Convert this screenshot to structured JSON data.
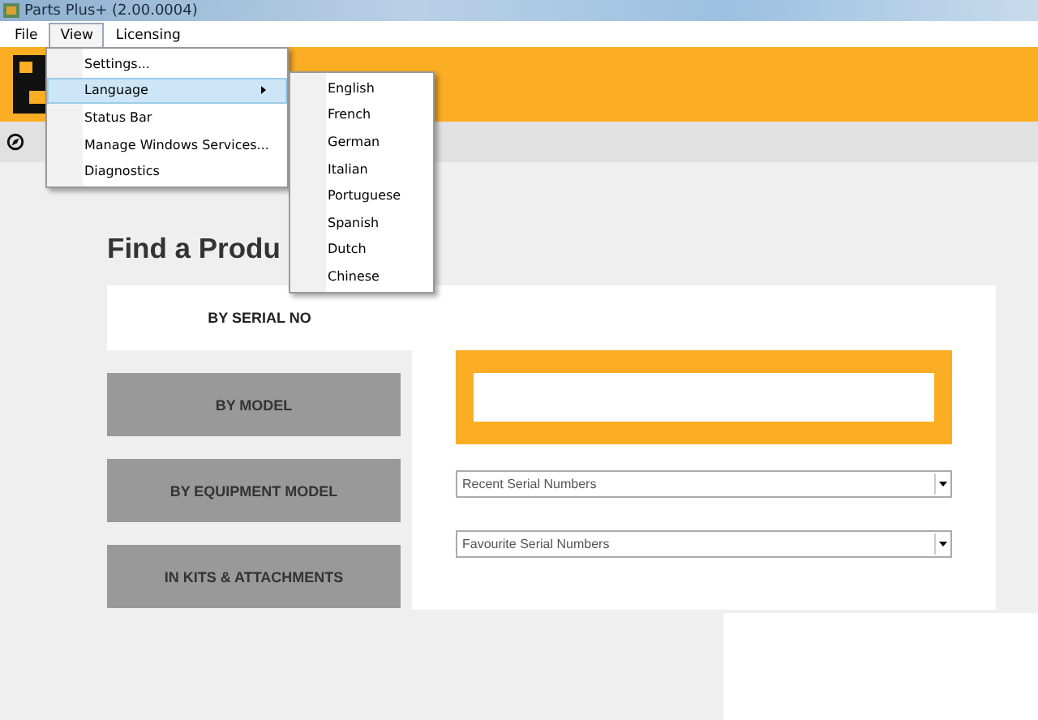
{
  "window": {
    "title": "Parts Plus+ (2.00.0004)"
  },
  "menu_bar": [
    {
      "label": "File",
      "selected": false
    },
    {
      "label": "View",
      "selected": true
    },
    {
      "label": "Licensing",
      "selected": false
    }
  ],
  "view_menu": [
    {
      "label": "Settings...",
      "highlighted": false,
      "submenu": false
    },
    {
      "label": "Language",
      "highlighted": true,
      "submenu": true
    },
    {
      "label": "Status Bar",
      "highlighted": false,
      "submenu": false
    },
    {
      "label": "Manage Windows Services...",
      "highlighted": false,
      "submenu": false
    },
    {
      "label": "Diagnostics",
      "highlighted": false,
      "submenu": false
    }
  ],
  "language_menu": [
    "English",
    "French",
    "German",
    "Italian",
    "Portuguese",
    "Spanish",
    "Dutch",
    "Chinese"
  ],
  "heading": "Find a Produ",
  "search_tabs": [
    {
      "label": "BY SERIAL NO",
      "selected": true
    },
    {
      "label": "BY MODEL",
      "selected": false
    },
    {
      "label": "BY EQUIPMENT MODEL",
      "selected": false
    },
    {
      "label": "IN KITS & ATTACHMENTS",
      "selected": false
    }
  ],
  "dropdowns": [
    {
      "value": "Recent Serial Numbers"
    },
    {
      "value": "Favourite Serial Numbers"
    }
  ]
}
